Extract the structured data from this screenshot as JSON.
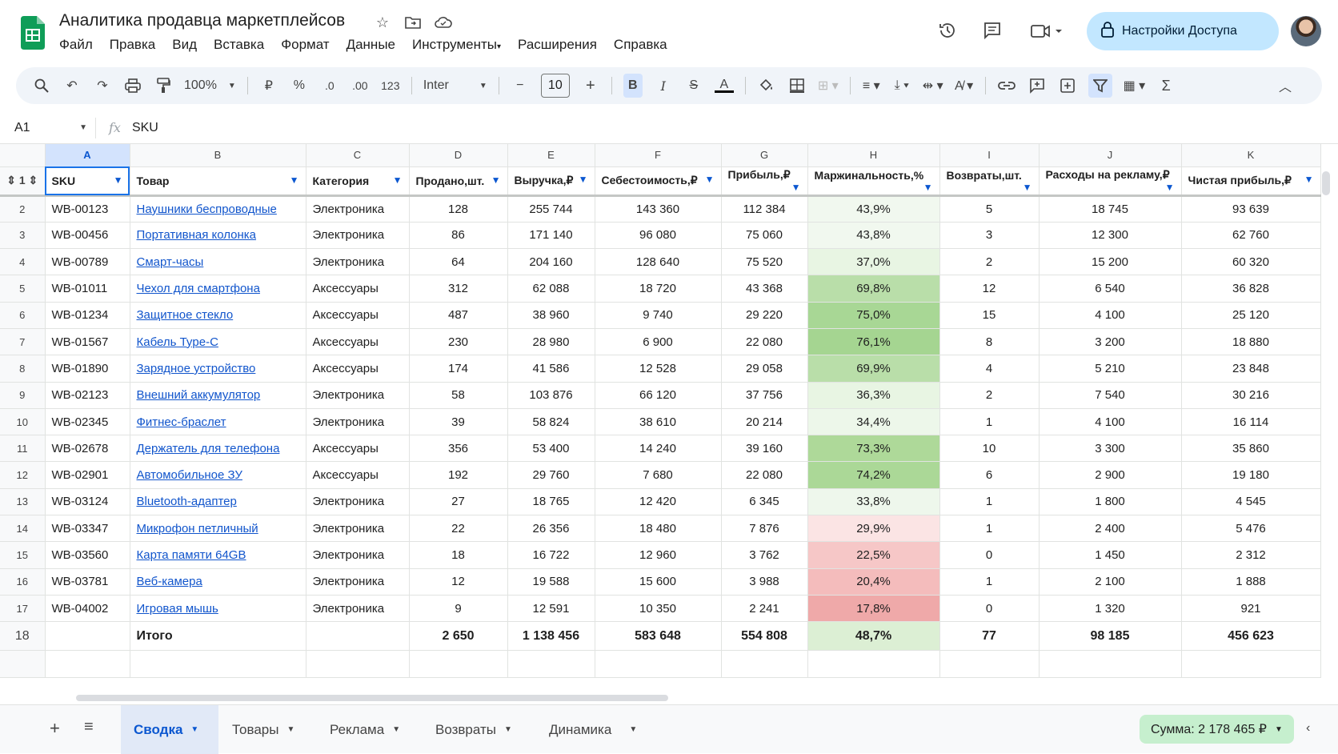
{
  "doc": {
    "title": "Аналитика продавца маркетплейсов",
    "menu": [
      "Файл",
      "Правка",
      "Вид",
      "Вставка",
      "Формат",
      "Данные",
      "Инструменты",
      "Расширения",
      "Справка"
    ],
    "share_label": "Настройки Доступа"
  },
  "toolbar": {
    "zoom": "100%",
    "currency": "₽",
    "percent": "%",
    "dec_less": ".0",
    "dec_more": ".00",
    "number_format": "123",
    "font": "Inter",
    "font_size": "10"
  },
  "formula": {
    "cell_ref": "A1",
    "content": "SKU"
  },
  "columns": [
    "A",
    "B",
    "C",
    "D",
    "E",
    "F",
    "G",
    "H",
    "I",
    "J",
    "K"
  ],
  "header": {
    "row_num": "1",
    "cells": [
      "SKU",
      "Товар",
      "Категория",
      "Продано,шт.",
      "Выручка,₽",
      "Себестоимость,₽",
      "Прибыль,₽",
      "Маржинальность,%",
      "Возвраты,шт.",
      "Расходы на рекламу,₽",
      "Чистая прибыль,₽"
    ]
  },
  "rows": [
    {
      "n": "2",
      "sku": "WB-00123",
      "product": "Наушники беспроводные",
      "category": "Электроника",
      "sold": "128",
      "revenue": "255 744",
      "cost": "143 360",
      "profit": "112 384",
      "margin": "43,9%",
      "margin_color": "#f1f8ef",
      "returns": "5",
      "ads": "18 745",
      "net": "93 639"
    },
    {
      "n": "3",
      "sku": "WB-00456",
      "product": "Портативная колонка",
      "category": "Электроника",
      "sold": "86",
      "revenue": "171 140",
      "cost": "96 080",
      "profit": "75 060",
      "margin": "43,8%",
      "margin_color": "#f1f8ef",
      "returns": "3",
      "ads": "12 300",
      "net": "62 760"
    },
    {
      "n": "4",
      "sku": "WB-00789",
      "product": "Смарт-часы",
      "category": "Электроника",
      "sold": "64",
      "revenue": "204 160",
      "cost": "128 640",
      "profit": "75 520",
      "margin": "37,0%",
      "margin_color": "#e8f5e3",
      "returns": "2",
      "ads": "15 200",
      "net": "60 320"
    },
    {
      "n": "5",
      "sku": "WB-01011",
      "product": "Чехол для смартфона",
      "category": "Аксессуары",
      "sold": "312",
      "revenue": "62 088",
      "cost": "18 720",
      "profit": "43 368",
      "margin": "69,8%",
      "margin_color": "#b9dea9",
      "returns": "12",
      "ads": "6 540",
      "net": "36 828"
    },
    {
      "n": "6",
      "sku": "WB-01234",
      "product": "Защитное стекло",
      "category": "Аксессуары",
      "sold": "487",
      "revenue": "38 960",
      "cost": "9 740",
      "profit": "29 220",
      "margin": "75,0%",
      "margin_color": "#a8d795",
      "returns": "15",
      "ads": "4 100",
      "net": "25 120"
    },
    {
      "n": "7",
      "sku": "WB-01567",
      "product": "Кабель Type-C",
      "category": "Аксессуары",
      "sold": "230",
      "revenue": "28 980",
      "cost": "6 900",
      "profit": "22 080",
      "margin": "76,1%",
      "margin_color": "#a5d591",
      "returns": "8",
      "ads": "3 200",
      "net": "18 880"
    },
    {
      "n": "8",
      "sku": "WB-01890",
      "product": "Зарядное устройство",
      "category": "Аксессуары",
      "sold": "174",
      "revenue": "41 586",
      "cost": "12 528",
      "profit": "29 058",
      "margin": "69,9%",
      "margin_color": "#b9dea9",
      "returns": "4",
      "ads": "5 210",
      "net": "23 848"
    },
    {
      "n": "9",
      "sku": "WB-02123",
      "product": "Внешний аккумулятор",
      "category": "Электроника",
      "sold": "58",
      "revenue": "103 876",
      "cost": "66 120",
      "profit": "37 756",
      "margin": "36,3%",
      "margin_color": "#e8f5e3",
      "returns": "2",
      "ads": "7 540",
      "net": "30 216"
    },
    {
      "n": "10",
      "sku": "WB-02345",
      "product": "Фитнес-браслет",
      "category": "Электроника",
      "sold": "39",
      "revenue": "58 824",
      "cost": "38 610",
      "profit": "20 214",
      "margin": "34,4%",
      "margin_color": "#edf7ea",
      "returns": "1",
      "ads": "4 100",
      "net": "16 114"
    },
    {
      "n": "11",
      "sku": "WB-02678",
      "product": "Держатель для телефона",
      "category": "Аксессуары",
      "sold": "356",
      "revenue": "53 400",
      "cost": "14 240",
      "profit": "39 160",
      "margin": "73,3%",
      "margin_color": "#aed999",
      "returns": "10",
      "ads": "3 300",
      "net": "35 860"
    },
    {
      "n": "12",
      "sku": "WB-02901",
      "product": "Автомобильное ЗУ",
      "category": "Аксессуары",
      "sold": "192",
      "revenue": "29 760",
      "cost": "7 680",
      "profit": "22 080",
      "margin": "74,2%",
      "margin_color": "#abd897",
      "returns": "6",
      "ads": "2 900",
      "net": "19 180"
    },
    {
      "n": "13",
      "sku": "WB-03124",
      "product": "Bluetooth-адаптер",
      "category": "Электроника",
      "sold": "27",
      "revenue": "18 765",
      "cost": "12 420",
      "profit": "6 345",
      "margin": "33,8%",
      "margin_color": "#eef7ec",
      "returns": "1",
      "ads": "1 800",
      "net": "4 545"
    },
    {
      "n": "14",
      "sku": "WB-03347",
      "product": "Микрофон петличный",
      "category": "Электроника",
      "sold": "22",
      "revenue": "26 356",
      "cost": "18 480",
      "profit": "7 876",
      "margin": "29,9%",
      "margin_color": "#fbe4e4",
      "returns": "1",
      "ads": "2 400",
      "net": "5 476"
    },
    {
      "n": "15",
      "sku": "WB-03560",
      "product": "Карта памяти 64GB",
      "category": "Электроника",
      "sold": "18",
      "revenue": "16 722",
      "cost": "12 960",
      "profit": "3 762",
      "margin": "22,5%",
      "margin_color": "#f6c7c7",
      "returns": "0",
      "ads": "1 450",
      "net": "2 312"
    },
    {
      "n": "16",
      "sku": "WB-03781",
      "product": "Веб-камера",
      "category": "Электроника",
      "sold": "12",
      "revenue": "19 588",
      "cost": "15 600",
      "profit": "3 988",
      "margin": "20,4%",
      "margin_color": "#f4bcbc",
      "returns": "1",
      "ads": "2 100",
      "net": "1 888"
    },
    {
      "n": "17",
      "sku": "WB-04002",
      "product": "Игровая мышь",
      "category": "Электроника",
      "sold": "9",
      "revenue": "12 591",
      "cost": "10 350",
      "profit": "2 241",
      "margin": "17,8%",
      "margin_color": "#efa9a9",
      "returns": "0",
      "ads": "1 320",
      "net": "921"
    }
  ],
  "total": {
    "n": "18",
    "label": "Итого",
    "sold": "2 650",
    "revenue": "1 138 456",
    "cost": "583 648",
    "profit": "554 808",
    "margin": "48,7%",
    "returns": "77",
    "ads": "98 185",
    "net": "456 623"
  },
  "sheets": [
    "Сводка",
    "Товары",
    "Реклама",
    "Возвраты",
    "Динамика"
  ],
  "sum_label": "Сумма: 2 178 465 ₽"
}
